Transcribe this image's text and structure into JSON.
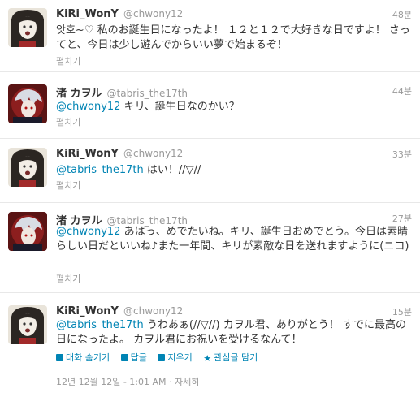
{
  "tweets": [
    {
      "name": "KiRi_WonY",
      "handle": "@chwony12",
      "time": "48분",
      "mention": "",
      "text": "앗호~♡ 私のお誕生日になったよ！ １２と１２で大好きな日ですよ！ さってと、今日は少し遊んでからいい夢で始まるぞ！",
      "expand": "펼치기"
    },
    {
      "name": "渚 カヲル",
      "handle": "@tabris_the17th",
      "time": "44분",
      "mention": "@chwony12",
      "text": " キリ、誕生日なのかい？",
      "expand": "펼치기"
    },
    {
      "name": "KiRi_WonY",
      "handle": "@chwony12",
      "time": "33분",
      "mention": "@tabris_the17th",
      "text": " はい！//▽//",
      "expand": "펼치기"
    },
    {
      "name": "渚 カヲル",
      "handle": "@tabris_the17th",
      "time": "27분",
      "mention": "@chwony12",
      "text": " あはっ、めでたいね。キリ、誕生日おめでとう。今日は素晴らしい日だといいね♪また一年間、キリが素敵な日を送れますように(ニコ)",
      "expand": "펼치기"
    },
    {
      "name": "KiRi_WonY",
      "handle": "@chwony12",
      "time": "15분",
      "mention": "@tabris_the17th",
      "text": " うわあぁ(//▽//) カヲル君、ありがとう！ すでに最高の日になったよ。 カヲル君にお祝いを受けるなんて！",
      "expand": ""
    }
  ],
  "actions": {
    "hide_conversation": "대화 숨기기",
    "reply": "답글",
    "delete": "지우기",
    "favorite": "관심글 담기"
  },
  "meta": {
    "timestamp": "12년 12월 12일 - 1:01 AM",
    "details": "자세히"
  }
}
